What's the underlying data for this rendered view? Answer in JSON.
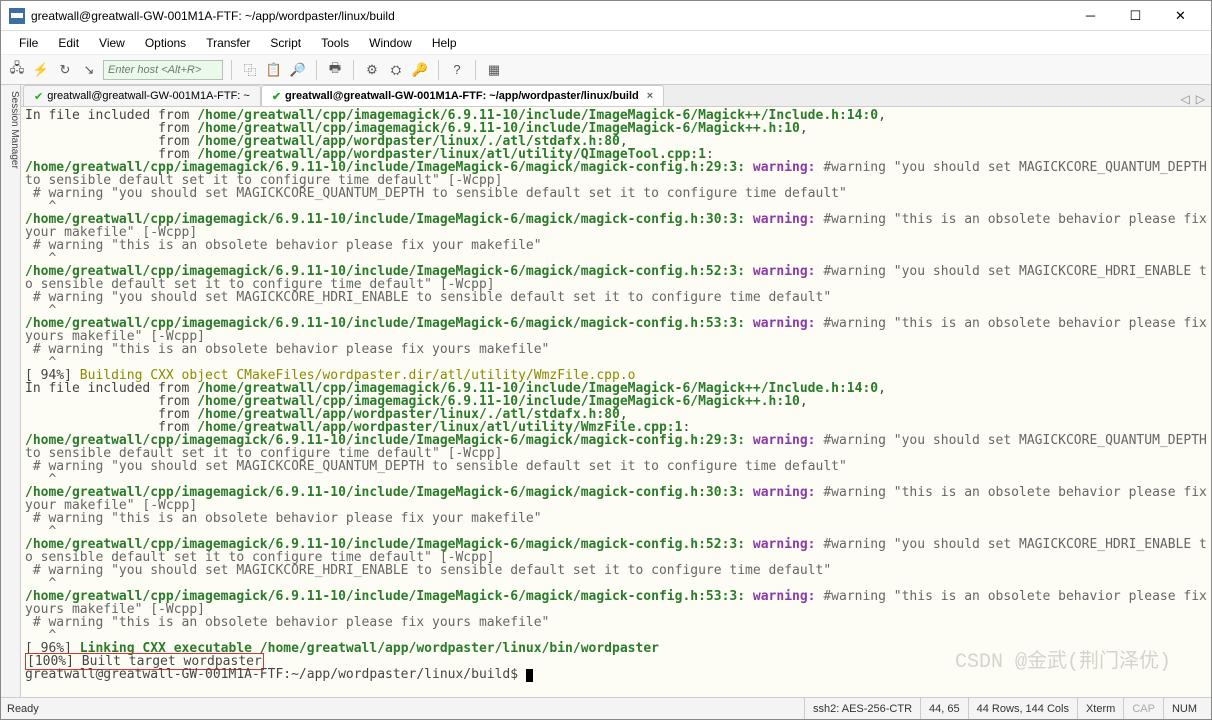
{
  "window": {
    "title": "greatwall@greatwall-GW-001M1A-FTF: ~/app/wordpaster/linux/build"
  },
  "menu": [
    "File",
    "Edit",
    "View",
    "Options",
    "Transfer",
    "Script",
    "Tools",
    "Window",
    "Help"
  ],
  "toolbar": {
    "host_placeholder": "Enter host <Alt+R>"
  },
  "tabs": [
    {
      "label": "greatwall@greatwall-GW-001M1A-FTF: ~",
      "active": false
    },
    {
      "label": "greatwall@greatwall-GW-001M1A-FTF: ~/app/wordpaster/linux/build",
      "active": true
    }
  ],
  "term": {
    "inc1_from": "In file included from ",
    "inc1_p": "/home/greatwall/cpp/imagemagick/6.9.11-10/include/ImageMagick-6/Magick++/Include.h:14:0",
    "inc2_from": "                 from ",
    "inc2_p": "/home/greatwall/cpp/imagemagick/6.9.11-10/include/ImageMagick-6/Magick++.h:10",
    "inc3_p": "/home/greatwall/app/wordpaster/linux/./atl/stdafx.h:80",
    "inc4_p": "/home/greatwall/app/wordpaster/linux/atl/utility/QImageTool.cpp:1",
    "w29_pre": "/home/greatwall/cpp/imagemagick/6.9.11-10/include/ImageMagick-6/magick/magick-config.h:29:3: ",
    "warn": "warning: ",
    "w29_msg": "#warning \"you should set MAGICKCORE_QUANTUM_DEPTH to sensible default set it to configure time default\" [-Wcpp]",
    "w29_echo": " # warning \"you should set MAGICKCORE_QUANTUM_DEPTH to sensible default set it to configure time default\"",
    "caret": "   ^",
    "w30_pre": "/home/greatwall/cpp/imagemagick/6.9.11-10/include/ImageMagick-6/magick/magick-config.h:30:3: ",
    "w30_msg": "#warning \"this is an obsolete behavior please fix your makefile\" [-Wcpp]",
    "w30_echo": " # warning \"this is an obsolete behavior please fix your makefile\"",
    "w52_pre": "/home/greatwall/cpp/imagemagick/6.9.11-10/include/ImageMagick-6/magick/magick-config.h:52:3: ",
    "w52_msg": "#warning \"you should set MAGICKCORE_HDRI_ENABLE to sensible default set it to configure time default\" [-Wcpp]",
    "w52_echo": " # warning \"you should set MAGICKCORE_HDRI_ENABLE to sensible default set it to configure time default\"",
    "w53_pre": "/home/greatwall/cpp/imagemagick/6.9.11-10/include/ImageMagick-6/magick/magick-config.h:53:3: ",
    "w53_msg": "#warning \"this is an obsolete behavior please fix yours makefile\" [-Wcpp]",
    "w53_echo": " # warning \"this is an obsolete behavior please fix yours makefile\"",
    "prog94": "[ 94%] ",
    "build_wmz": "Building CXX object CMakeFiles/wordpaster.dir/atl/utility/WmzFile.cpp.o",
    "inc_wmz": "/home/greatwall/app/wordpaster/linux/atl/utility/WmzFile.cpp:1",
    "prog96": "[ 96%] ",
    "link": "Linking CXX executable /home/greatwall/app/wordpaster/linux/bin/wordpaster",
    "prog100": "[100%] Built target wordpaster",
    "prompt": "greatwall@greatwall-GW-001M1A-FTF:~/app/wordpaster/linux/build$ "
  },
  "status": {
    "ready": "Ready",
    "conn": "ssh2: AES-256-CTR",
    "pos": "44,  65",
    "size": "44 Rows, 144 Cols",
    "term": "Xterm",
    "caps": "CAP",
    "num": "NUM"
  },
  "watermark": "CSDN @金武(荆门泽优)"
}
